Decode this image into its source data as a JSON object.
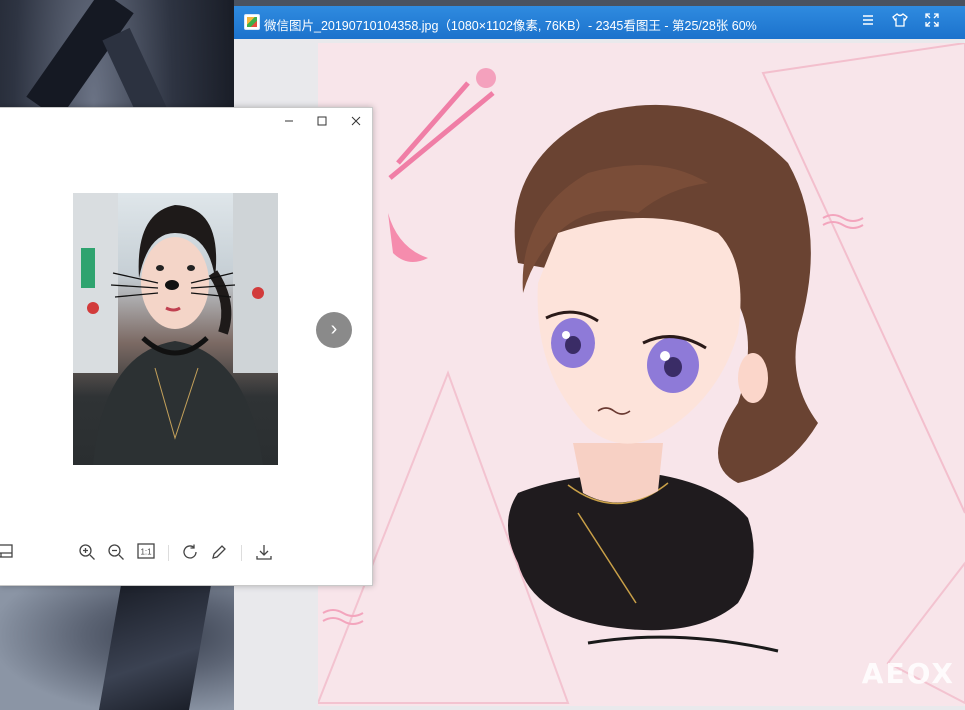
{
  "viewer": {
    "title": "微信图片_20190710104358.jpg（1080×1102像素, 76KB）- 2345看图王 - 第25/28张 60%",
    "icons": {
      "menu": "menu-icon",
      "skin": "shirt-icon",
      "fullscreen": "fullscreen-icon"
    },
    "watermark": "AEOX",
    "accent": "#2a85de"
  },
  "photo_window": {
    "controls": [
      "minimize-icon",
      "maximize-icon",
      "close-icon"
    ],
    "next_glyph": "›",
    "toolbar": [
      "layout-icon",
      "zoom-in-icon",
      "zoom-out-icon",
      "actual-size-icon",
      "rotate-icon",
      "edit-icon",
      "download-icon"
    ],
    "actual_size_label": "1:1"
  }
}
